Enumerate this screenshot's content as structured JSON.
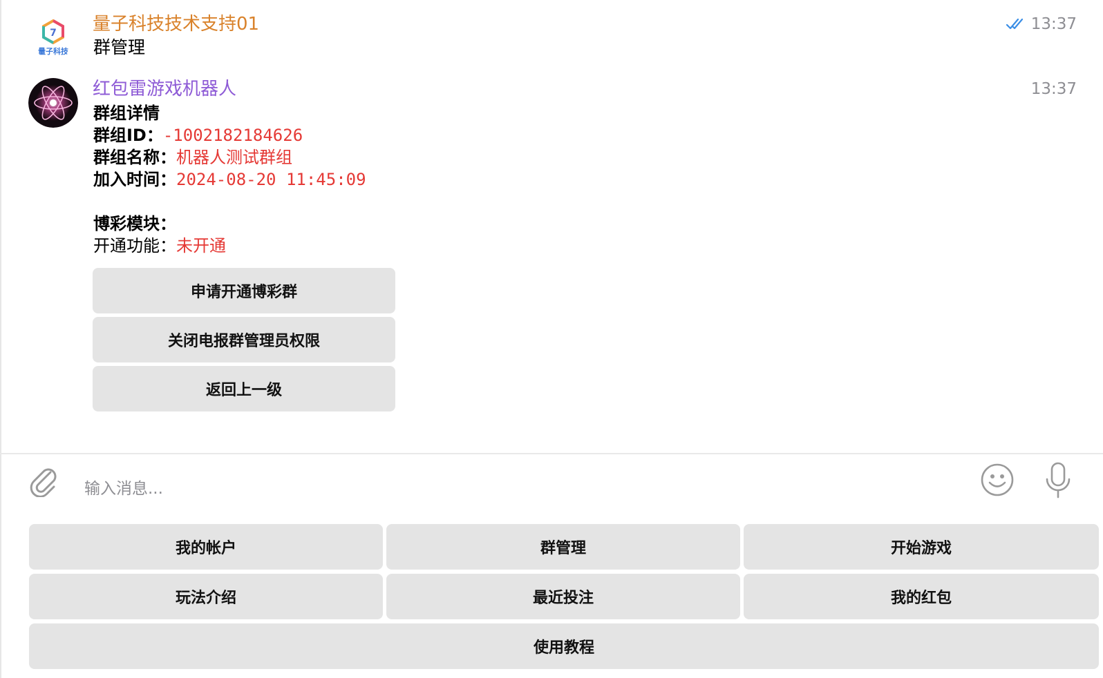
{
  "messages": [
    {
      "sender": "量子科技技术支持01",
      "sender_color": "#d9822b",
      "avatar_label": "量子科技",
      "text": "群管理",
      "time": "13:37",
      "read_status": "double-check"
    },
    {
      "sender": "红包雷游戏机器人",
      "sender_color": "#8e5bd6",
      "time": "13:37",
      "title": "群组详情",
      "group_id_label": "群组ID：",
      "group_id_value": "-1002182184626",
      "group_name_label": "群组名称：",
      "group_name_value": "机器人测试群组",
      "join_time_label": "加入时间：",
      "join_time_value": "2024-08-20 11:45:09",
      "module_title": "博彩模块：",
      "feature_label": "开通功能：",
      "feature_value": "未开通",
      "inline_buttons": [
        "申请开通博彩群",
        "关闭电报群管理员权限",
        "返回上一级"
      ]
    }
  ],
  "composer": {
    "placeholder": "输入消息...",
    "attach_icon": "paperclip-icon",
    "emoji_icon": "smiley-icon",
    "mic_icon": "microphone-icon"
  },
  "keyboard": {
    "rows": [
      [
        "我的帐户",
        "群管理",
        "开始游戏"
      ],
      [
        "玩法介绍",
        "最近投注",
        "我的红包"
      ],
      [
        "使用教程"
      ]
    ]
  },
  "colors": {
    "accent_blue": "#3a8ee6",
    "value_red": "#e53935",
    "button_bg": "#e4e4e4"
  }
}
